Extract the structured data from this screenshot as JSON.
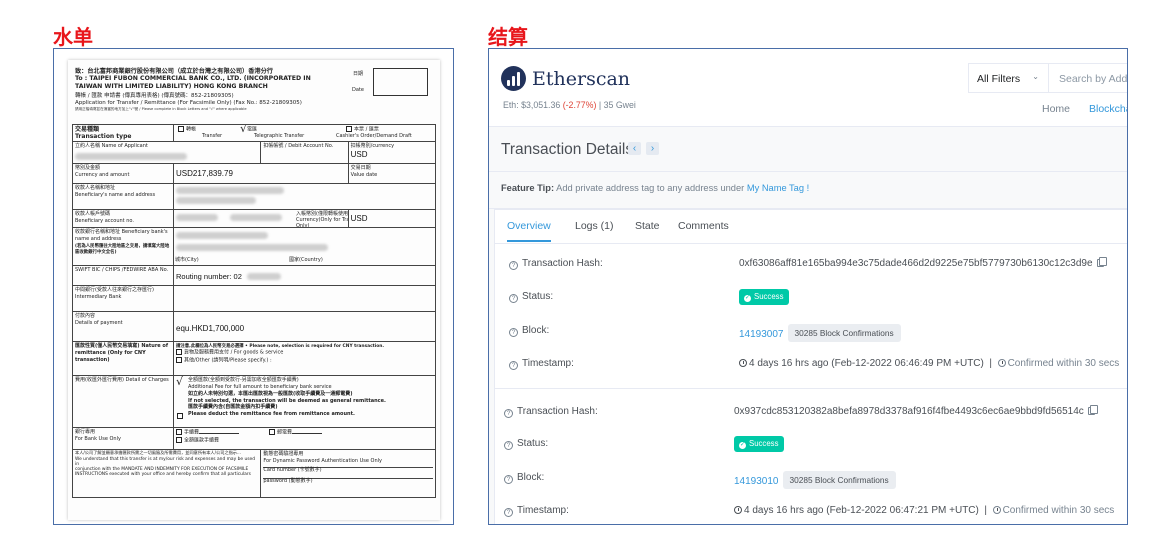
{
  "headings": {
    "left": "水单",
    "right": "结算"
  },
  "wire_form": {
    "to_line_cn": "致：台北富邦商業銀行股份有限公司（成立於台灣之有限公司）香港分行",
    "to_line_en": "To : TAIPEI FUBON COMMERCIAL BANK CO., LTD. (INCORPORATED IN",
    "to_line_en2": "TAIWAN WITH LIMITED LIABILITY) HONG KONG BRANCH",
    "app_cn": "轉帳 / 匯款 申請書 (傳真專用表格) (傳真號碼：852-21809305)",
    "app_en": "Application for Transfer / Remittance (For Facsimile Only) (Fax No.: 852-21809305)",
    "note": "請用正楷填寫並在適當的地方加上\"√\"號 / Please complete in Block Letters and \"√\" where applicable",
    "date_cn": "日期",
    "date_en": "Date",
    "tx_type_cn": "交易種類",
    "tx_type_en": "Transaction type",
    "transfer_cn": "轉帳",
    "transfer_en": "Transfer",
    "tt_cn": "電匯",
    "tt_en": "Telegraphic Transfer",
    "order_cn": "本票 / 匯票",
    "order_en": "Cashier's Order/Demand Draft",
    "tick": "√",
    "applicant_label": "立約人名稱 Name of Applicant",
    "debit_label": "扣帳帳號 / Debit Account No.",
    "debit_ccy_label": "扣帳幣別/currency",
    "debit_ccy": "USD",
    "ccy_amt_label_cn": "幣別及金額",
    "ccy_amt_label_en": "Currency and amount",
    "amount": "USD217,839.79",
    "value_date_cn": "交易日期",
    "value_date_en": "Value date",
    "benef_label_cn": "收款人名稱和地址",
    "benef_label_en": "Beneficiary's name and address",
    "benef_acct_cn": "收款人帳戶號碼",
    "benef_acct_en": "Beneficiary account no.",
    "benef_ccy_label": "入帳幣別(僅限轉帳使用) Currency(Only for Transfer Only)",
    "benef_ccy": "USD",
    "bank_label": "收款銀行名稱和地址 Beneficiary bank's name and address",
    "bank_label2": "(若為人民幣匯往大陸地區之交易，請填寫大陸地區收款銀行中文全名)",
    "city": "城市(City)",
    "country": "國家(Country)",
    "swift_label": "SWIFT BIC / CHIPS /FEDWIRE ABA No.",
    "routing": "Routing number: 02",
    "inter_label": "中間銀行(受款人往來銀行之存匯行) Intermediary Bank",
    "payment_label_cn": "付款內容",
    "payment_label_en": "Details of payment",
    "payment": "equ.HKD1,700,000",
    "nature_label": "匯款性質(僅人民幣交易填寫) Nature of remittance (Only for CNY transaction)",
    "nature_bold": "請注意,此欄位為人民幣交易必選擇 • Please note, selection is required for CNY transaction.",
    "nature_opt1": "貨物及服務費用支付 / For goods & service",
    "nature_opt2": "其他/Other (請列明/Please specify.) :",
    "charges_label": "費用(收匯外匯行費用) Detail of Charges",
    "charges_opt1": "全額匯款(全額到受款行-另需加收全額匯款手續費)",
    "charges_opt1_en": "Additional Fee for full amount to beneficiary bank service",
    "charges_bold1": "如立約人未特別勾選，本匯出匯款視為一般匯款(收取手續費及一通郵電費)",
    "charges_bold2": "If not selected, the transaction will be deemed as general remittance.",
    "charges_opt2": "匯款手續費內含(自匯款金額內扣手續費)",
    "charges_opt2_en": "Please deduct the remittance fee from remittance amount.",
    "bank_use_cn": "銀行專用",
    "bank_use_en": "For Bank Use Only",
    "fee_cn": "手續費",
    "telex_cn": "郵電費",
    "full_cn": "全額匯款手續費",
    "footer_cn": "本人/公司了解並願意承擔匯款所需之一切風險及所需費用，並同意所有本人/公司之指示...",
    "footer_en1": "We understand that this transfer is at my/our risk and expenses and may be used in",
    "footer_en2": "conjunction with the MANDATE AND INDEMNITY FOR EXECUTION OF FACSIMILE",
    "footer_en3": "INSTRUCTIONS executed with your office and hereby confirm that all particulars",
    "auth_title": "動態密碼驗證專用",
    "auth_en": "For Dynamic Password Authentication Use Only",
    "card_label": "Card number (卡號數字)",
    "pass_label": "password (動態數字)"
  },
  "etherscan": {
    "logo": "Etherscan",
    "price_prefix": "Eth: $3,051.36",
    "price_change": "(-2.77%)",
    "gas": "| 35 Gwei",
    "filter_label": "All Filters",
    "search_placeholder": "Search by Address",
    "nav": [
      "Home",
      "Blockchain"
    ],
    "page_title": "Transaction Details",
    "tip_label": "Feature Tip:",
    "tip_text": "Add private address tag to any address under",
    "tip_link": "My Name Tag !",
    "tabs": [
      "Overview",
      "Logs (1)",
      "State",
      "Comments"
    ],
    "tx1": {
      "hash_label": "Transaction Hash:",
      "hash": "0xf63086aff81e165ba994e3c75dade466d2d9225e75bf5779730b6130c12c3d9e",
      "status_label": "Status:",
      "status": "Success",
      "block_label": "Block:",
      "block": "14193007",
      "confirmations": "30285 Block Confirmations",
      "time_label": "Timestamp:",
      "time": "4 days 16 hrs ago (Feb-12-2022 06:46:49 PM +UTC)",
      "confirmed": "Confirmed within 30 secs"
    },
    "tx2": {
      "hash_label": "Transaction Hash:",
      "hash": "0x937cdc853120382a8befa8978d3378af916f4fbe4493c6ec6ae9bbd9fd56514c",
      "status_label": "Status:",
      "status": "Success",
      "block_label": "Block:",
      "block": "14193010",
      "confirmations": "30285 Block Confirmations",
      "time_label": "Timestamp:",
      "time": "4 days 16 hrs ago (Feb-12-2022 06:47:21 PM +UTC)",
      "confirmed": "Confirmed within 30 secs"
    }
  }
}
